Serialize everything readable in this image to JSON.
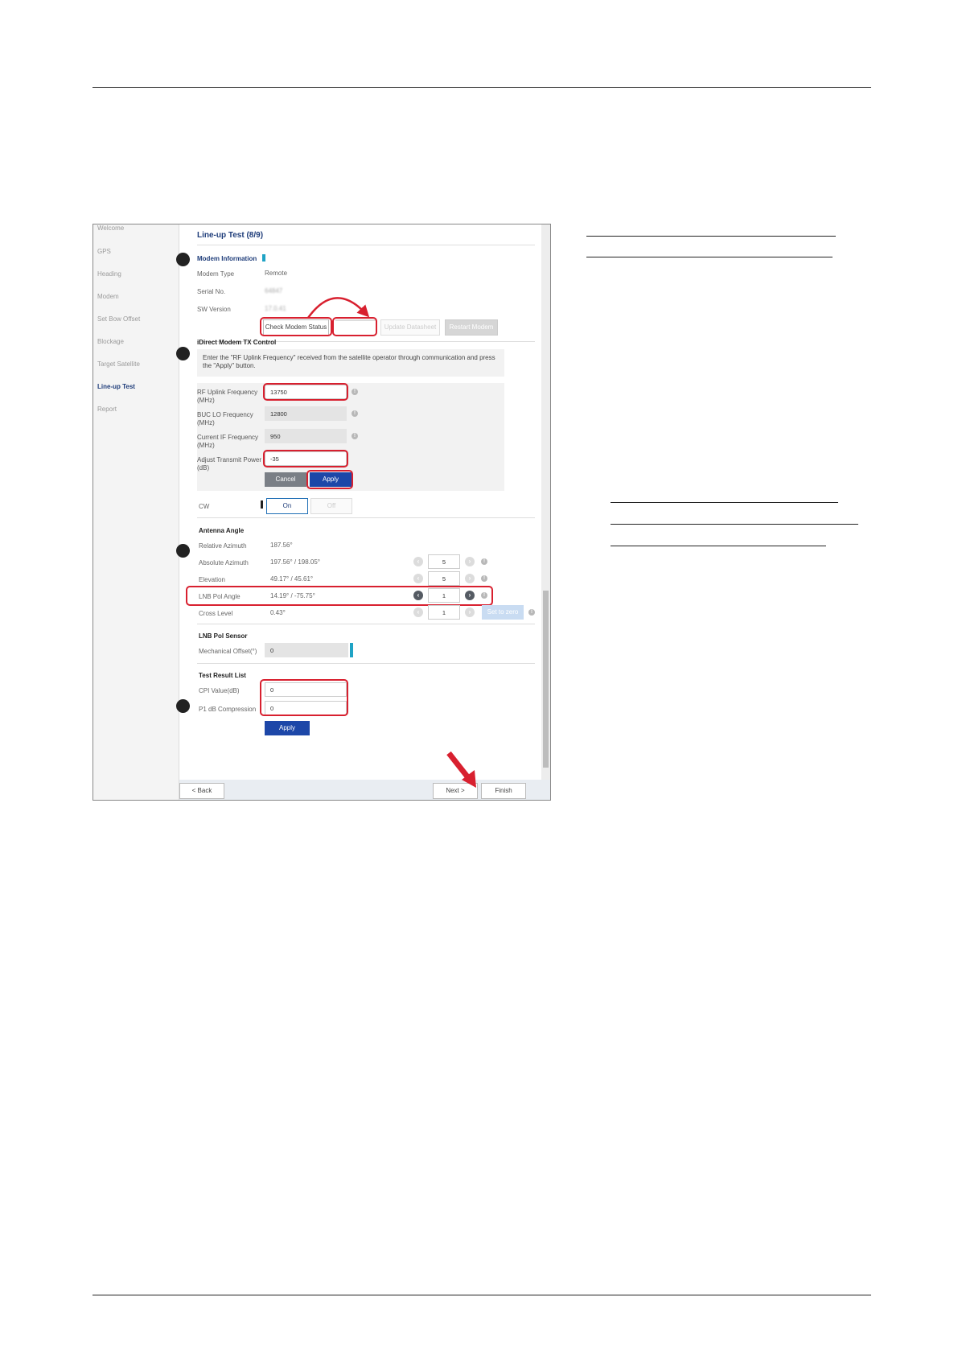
{
  "sidebar": {
    "items": [
      "Welcome",
      "GPS",
      "Heading",
      "Modem",
      "Set Bow Offset",
      "Blockage",
      "Target Satellite",
      "Line-up Test",
      "Report"
    ],
    "active_index": 7
  },
  "page_title": "Line-up Test (8/9)",
  "modem_info": {
    "heading": "Modem Information",
    "rows": [
      {
        "label": "Modem Type",
        "value": "Remote"
      },
      {
        "label": "Serial No.",
        "value": "64847"
      },
      {
        "label": "SW Version",
        "value": "17.0.41"
      }
    ],
    "buttons": {
      "check": "Check Modem Status",
      "second": "",
      "third": "Update Datasheet",
      "fourth": "Restart Modem"
    }
  },
  "tx_control": {
    "heading": "iDirect Modem TX Control",
    "instruction": "Enter the \"RF Uplink Frequency\" received from the satellite operator through communication and press the \"Apply\" button.",
    "fields": [
      {
        "label": "RF Uplink Frequency",
        "unit": "(MHz)",
        "value": "13750"
      },
      {
        "label": "BUC LO Frequency",
        "unit": "(MHz)",
        "value": "12800"
      },
      {
        "label": "Current IF Frequency",
        "unit": "(MHz)",
        "value": "950"
      },
      {
        "label": "Adjust Transmit Power",
        "unit": "(dB)",
        "value": "-35"
      }
    ],
    "cancel_label": "Cancel",
    "apply_label": "Apply",
    "cw_label": "CW",
    "cw_on": "On",
    "cw_off": "Off"
  },
  "antenna_angle": {
    "heading": "Antenna Angle",
    "rows": [
      {
        "label": "Relative Azimuth",
        "value": "187.56°",
        "step": ""
      },
      {
        "label": "Absolute Azimuth",
        "value": "197.56° / 198.05°",
        "step": "5"
      },
      {
        "label": "Elevation",
        "value": "49.17° / 45.61°",
        "step": "5"
      },
      {
        "label": "LNB Pol Angle",
        "value": "14.19° / -75.75°",
        "step": "1"
      },
      {
        "label": "Cross Level",
        "value": "0.43°",
        "step": "1"
      }
    ],
    "set_to_zero": "Set to zero"
  },
  "lnb_sensor": {
    "heading": "LNB Pol Sensor",
    "label": "Mechanical Offset(°)",
    "value": "0"
  },
  "test_result": {
    "heading": "Test Result List",
    "rows": [
      {
        "label": "CPI Value(dB)",
        "value": "0"
      },
      {
        "label": "P1 dB Compression",
        "value": "0"
      }
    ],
    "apply_label": "Apply"
  },
  "footer": {
    "back": "< Back",
    "next": "Next >",
    "finish": "Finish"
  },
  "colors": {
    "highlight": "#d8202f",
    "primary": "#1d47a8",
    "title": "#1f3d7a",
    "accent": "#1fa3c5"
  }
}
